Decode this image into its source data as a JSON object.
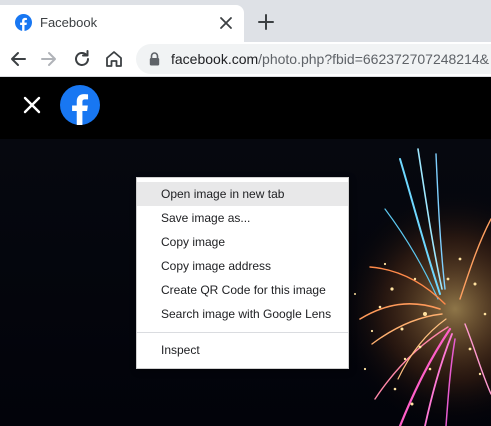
{
  "browser": {
    "tab": {
      "title": "Facebook",
      "favicon": "facebook-favicon-icon",
      "close_icon": "close-icon"
    },
    "new_tab_icon": "plus-icon",
    "nav": {
      "back_icon": "arrow-left-icon",
      "forward_icon": "arrow-right-icon",
      "reload_icon": "reload-icon",
      "home_icon": "home-icon"
    },
    "address_bar": {
      "lock_icon": "lock-icon",
      "host": "facebook.com",
      "path": "/photo.php?fbid=662372707248214&"
    }
  },
  "page": {
    "close_icon": "close-icon",
    "logo": "facebook-logo-icon"
  },
  "context_menu": {
    "items": [
      "Open image in new tab",
      "Save image as...",
      "Copy image",
      "Copy image address",
      "Create QR Code for this image",
      "Search image with Google Lens"
    ],
    "footer_items": [
      "Inspect"
    ],
    "hovered_index": 0
  },
  "colors": {
    "facebook_blue": "#1877f2",
    "tabstrip": "#dee1e6",
    "omnibox": "#f1f3f4",
    "menu_hover": "#e8e8e9"
  }
}
